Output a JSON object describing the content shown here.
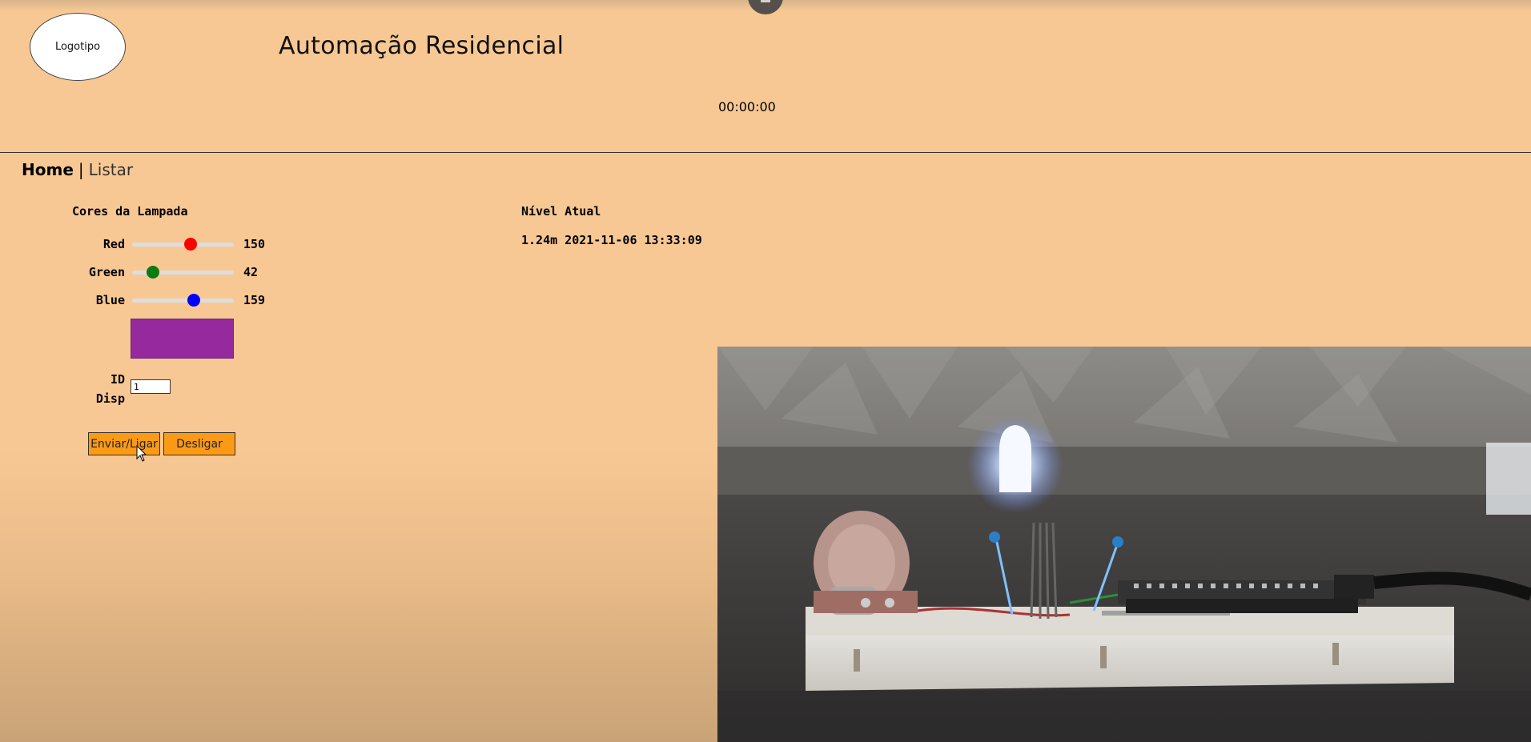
{
  "header": {
    "logo_text": "Logotipo",
    "title": "Automação Residencial",
    "clock": "00:00:00"
  },
  "nav": {
    "home": "Home",
    "separator": "|",
    "listar": "Listar"
  },
  "colors_panel": {
    "heading": "Cores da Lampada",
    "rows": [
      {
        "label": "Red",
        "value": "150",
        "fraction": 0.588,
        "thumb_color": "#ff0000"
      },
      {
        "label": "Green",
        "value": "42",
        "fraction": 0.165,
        "thumb_color": "#0b7a12"
      },
      {
        "label": "Blue",
        "value": "159",
        "fraction": 0.624,
        "thumb_color": "#0000ff"
      }
    ],
    "swatch_color": "#96299e",
    "id_label_line1": "ID",
    "id_label_line2": "Disp",
    "id_value": "1",
    "send_button": "Enviar/Ligar",
    "off_button": "Desligar"
  },
  "level_panel": {
    "heading": "Nível Atual",
    "value": "1.24m 2021-11-06 13:33:09"
  },
  "colors": {
    "page_bg": "#f7c894",
    "button_bg": "#fb9a14"
  }
}
